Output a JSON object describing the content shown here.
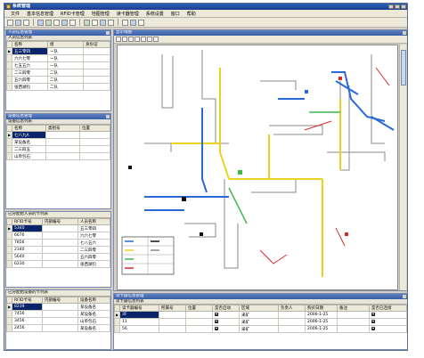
{
  "window": {
    "title": "系统管理"
  },
  "menu": [
    "文件",
    "基本信息管理",
    "RFID卡管理",
    "地图管理",
    "读卡器管理",
    "系统设置",
    "窗口",
    "帮助"
  ],
  "personnel_panel": {
    "title": "人员信息管理",
    "subtitle": "人员信息列表",
    "columns": [
      "名称",
      "组",
      "身份证"
    ],
    "rows": [
      {
        "name": "五三零四",
        "group": "一队"
      },
      {
        "name": "六六七零",
        "group": "一队"
      },
      {
        "name": "七五五六",
        "group": "一队"
      },
      {
        "name": "二三四零",
        "group": "二队"
      },
      {
        "name": "五六四零",
        "group": "二队"
      },
      {
        "name": "张西湖包",
        "group": "二队"
      }
    ]
  },
  "device_panel": {
    "title": "设备信息管理",
    "subtitle": "设备信息列表",
    "columns": [
      "名称",
      "类别号",
      "位置"
    ],
    "rows": [
      "七八九A",
      "某设备名",
      "二三四五",
      "山单包石"
    ]
  },
  "assigned_personnel": {
    "title": "已分配给人员的卡列表",
    "columns": [
      "RFID卡号",
      "内部编号",
      "人员名称"
    ],
    "rows": [
      {
        "rfid": "5340",
        "name": "五三零四"
      },
      {
        "rfid": "6676",
        "name": "六六七零"
      },
      {
        "rfid": "7856",
        "name": "七八五六"
      },
      {
        "rfid": "2340",
        "name": "二三四零"
      },
      {
        "rfid": "5640",
        "name": "五六四零"
      },
      {
        "rfid": "6230",
        "name": "张西湖包"
      }
    ]
  },
  "assigned_devices": {
    "title": "已分配给设备的卡列表",
    "columns": [
      "RFID卡号",
      "内部编号",
      "设备名称"
    ],
    "rows": [
      {
        "rfid": "8239",
        "name": "某设备名"
      },
      {
        "rfid": "7456",
        "name": "某设备名"
      },
      {
        "rfid": "3456",
        "name": "山单包石"
      },
      {
        "rfid": "2456",
        "name": "某设备名"
      }
    ]
  },
  "map_window": {
    "title": "显示地图"
  },
  "reader_panel": {
    "title": "读卡器信息管理",
    "subtitle": "读卡器信息列表",
    "columns": [
      "读卡器编号",
      "所属号",
      "位置",
      "是否启动",
      "区域",
      "负责人",
      "购买日期",
      "备注",
      "是否已连接"
    ],
    "rows": [
      {
        "id": "3F",
        "zone": "采矿",
        "date": "2006-1-25"
      },
      {
        "id": "11",
        "zone": "采矿",
        "date": "2006-1-25"
      },
      {
        "id": "56",
        "zone": "采矿",
        "date": "2006-1-25"
      }
    ]
  },
  "colors": {
    "titlebar": "#1b3f8c",
    "panel_header": "#3a5ea8",
    "selection": "#0a246a"
  }
}
